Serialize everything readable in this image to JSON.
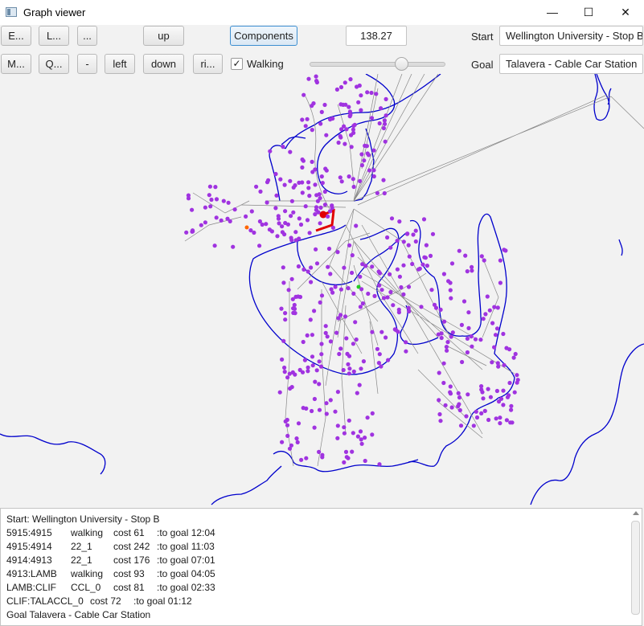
{
  "window": {
    "title": "Graph viewer",
    "minimize": "—",
    "maximize": "☐",
    "close": "✕"
  },
  "toolbar": {
    "row1": [
      "E...",
      "L...",
      "...",
      "up",
      "Components"
    ],
    "row2": [
      "M...",
      "Q...",
      "-",
      "left",
      "down",
      "ri..."
    ],
    "zoom_value": "138.27",
    "walking_label": "Walking",
    "walking_checked": true,
    "slider_value": 0.69,
    "start_label": "Start",
    "start_value": "Wellington University - Stop B",
    "goal_label": "Goal",
    "goal_value": "Talavera - Cable Car Station"
  },
  "colors": {
    "stop": "#a033e0",
    "edge": "#808080",
    "coast": "#0000cc",
    "path": "#e00000",
    "start": "#ff6600",
    "goal": "#22cc22"
  },
  "log": {
    "start": "Start: Wellington University - Stop B",
    "rows": [
      [
        "5915:4915",
        "walking",
        "cost 61",
        ":to goal 12:04"
      ],
      [
        "4915:4914",
        "22_1",
        "cost 242",
        ":to goal 11:03"
      ],
      [
        "4914:4913",
        "22_1",
        "cost 176",
        ":to goal 07:01"
      ],
      [
        "4913:LAMB",
        "walking",
        "cost 93",
        ":to goal 04:05"
      ],
      [
        "LAMB:CLIF",
        "CCL_0",
        "cost 81",
        ":to goal 02:33"
      ],
      [
        "CLIF:TALACCL_0",
        "cost 72",
        ":to goal 01:12",
        ""
      ]
    ],
    "goal": "Goal Talavera - Cable Car Station"
  }
}
